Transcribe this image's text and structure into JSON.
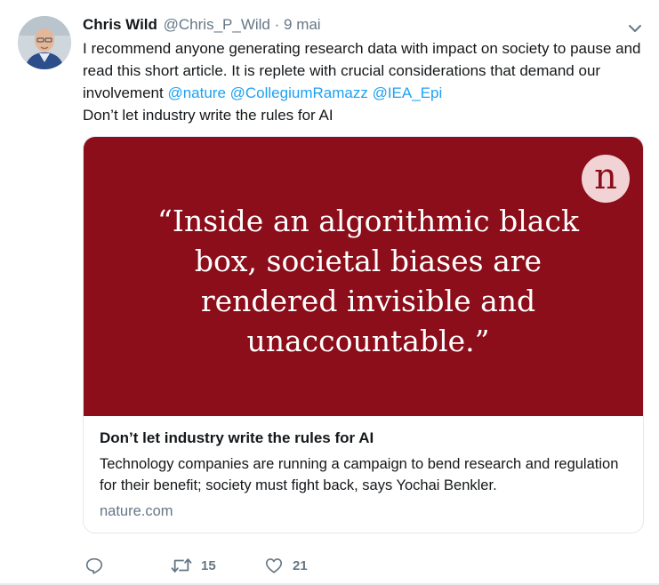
{
  "author": {
    "display_name": "Chris Wild",
    "handle": "@Chris_P_Wild",
    "separator": "·",
    "timestamp": "9 mai"
  },
  "tweet": {
    "line1": "I recommend anyone generating research data with impact on society to pause and read this short article. It is replete with crucial considerations that demand our involvement ",
    "mentions": [
      "@nature",
      "@CollegiumRamazz",
      "@IEA_Epi"
    ],
    "line2": "Don’t let industry write the rules for AI"
  },
  "card": {
    "logo_letter": "n",
    "quote_lines": [
      "“Inside an algorithmic black",
      "box, societal biases are",
      "rendered invisible and",
      "unaccountable.”"
    ],
    "title": "Don’t let industry write the rules for AI",
    "description": "Technology companies are running a campaign to bend research and regulation for their benefit; society must fight back, says Yochai Benkler.",
    "domain": "nature.com",
    "image_color": "#8b0e1a"
  },
  "actions": {
    "reply_icon": "reply-icon",
    "retweet_icon": "retweet-icon",
    "retweet_count": "15",
    "like_icon": "heart-icon",
    "like_count": "21"
  },
  "colors": {
    "link": "#1da1f2",
    "secondary_text": "#657786",
    "primary_text": "#14171a"
  }
}
